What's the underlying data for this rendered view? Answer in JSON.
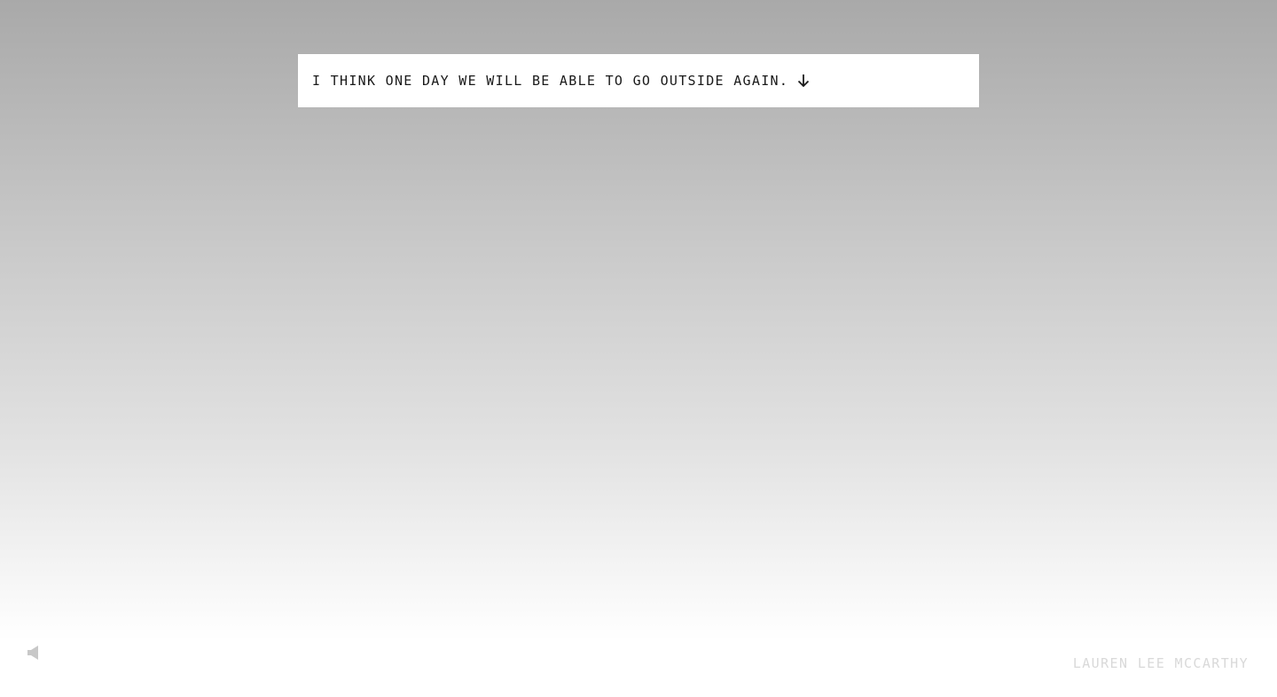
{
  "prompt": {
    "text": "I THINK ONE DAY WE WILL BE ABLE TO GO OUTSIDE AGAIN.",
    "icon": "arrow-down-icon"
  },
  "sound": {
    "icon": "speaker-icon"
  },
  "footer": {
    "credit": "LAUREN LEE MCCARTHY"
  },
  "colors": {
    "background_top": "#a9a9a9",
    "background_bottom": "#ffffff",
    "box": "#ffffff",
    "text": "#1a1a1a",
    "credit": "#d9d9d9"
  }
}
